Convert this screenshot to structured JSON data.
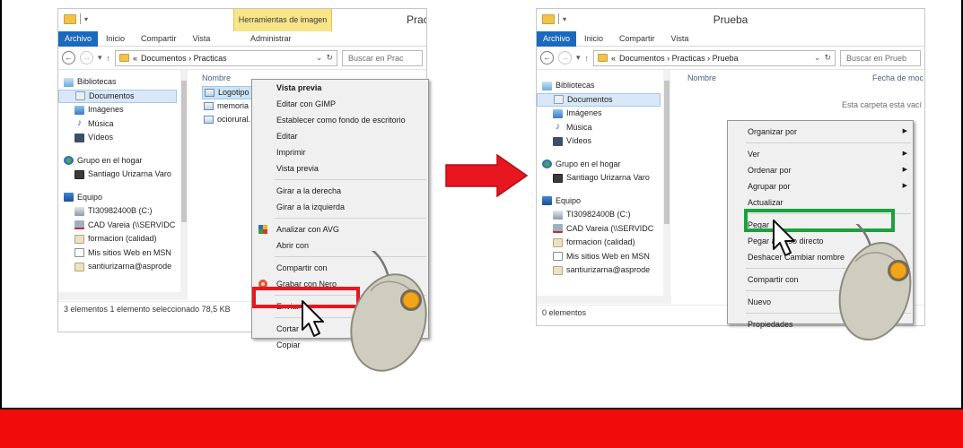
{
  "left": {
    "title": "Prac",
    "contextual_tab": "Herramientas de imagen",
    "ribbon": {
      "file": "Archivo",
      "tabs": [
        "Inicio",
        "Compartir",
        "Vista"
      ],
      "admin": "Administrar"
    },
    "address": {
      "prefix": "«",
      "path": "Documentos  ›  Practicas",
      "search": "Buscar en Prac"
    },
    "nav": [
      {
        "label": "Bibliotecas",
        "icon": "library-icon"
      },
      {
        "label": "Documentos",
        "icon": "documents-icon"
      },
      {
        "label": "Imágenes",
        "icon": "pictures-icon"
      },
      {
        "label": "Música",
        "icon": "music-icon"
      },
      {
        "label": "Vídeos",
        "icon": "videos-icon"
      },
      {
        "label": "Grupo en el hogar",
        "icon": "homegroup-icon"
      },
      {
        "label": "Santiago Urizarna Varo",
        "icon": "user-icon"
      },
      {
        "label": "Equipo",
        "icon": "computer-icon"
      },
      {
        "label": "TI30982400B (C:)",
        "icon": "drive-icon"
      },
      {
        "label": "CAD Vareia (\\\\SERVIDC",
        "icon": "network-drive-icon"
      },
      {
        "label": "formacion (calidad)",
        "icon": "network-folder-icon"
      },
      {
        "label": "Mis sitios Web en MSN",
        "icon": "page-icon"
      },
      {
        "label": "santiurizarna@asprode",
        "icon": "network-folder-icon"
      }
    ],
    "column_header": "Nombre",
    "files": [
      "Logotipo",
      "memoria",
      "ociorural."
    ],
    "status": "3 elementos    1 elemento seleccionado  78,5 KB",
    "menu": [
      {
        "label": "Vista previa",
        "bold": true
      },
      {
        "label": "Editar con GIMP"
      },
      {
        "label": "Establecer como fondo de escritorio"
      },
      {
        "label": "Editar"
      },
      {
        "label": "Imprimir"
      },
      {
        "label": "Vista previa"
      },
      {
        "sep": true
      },
      {
        "label": "Girar a la derecha"
      },
      {
        "label": "Girar a la izquierda"
      },
      {
        "sep": true
      },
      {
        "label": "Analizar con AVG",
        "icon": "avg-icon"
      },
      {
        "label": "Abrir con"
      },
      {
        "sep": true
      },
      {
        "label": "Compartir con"
      },
      {
        "label": "Grabar con Nero",
        "icon": "nero-icon"
      },
      {
        "sep": true
      },
      {
        "label": "Enviar a"
      },
      {
        "sep": true
      },
      {
        "label": "Cortar"
      },
      {
        "label": "Copiar"
      }
    ]
  },
  "right": {
    "title": "Prueba",
    "ribbon": {
      "file": "Archivo",
      "tabs": [
        "Inicio",
        "Compartir",
        "Vista"
      ]
    },
    "address": {
      "prefix": "«",
      "path": "Documentos  ›  Practicas  ›  Prueba",
      "search": "Buscar en Prueb"
    },
    "nav": [
      {
        "label": "Bibliotecas",
        "icon": "library-icon"
      },
      {
        "label": "Documentos",
        "icon": "documents-icon"
      },
      {
        "label": "Imágenes",
        "icon": "pictures-icon"
      },
      {
        "label": "Música",
        "icon": "music-icon"
      },
      {
        "label": "Vídeos",
        "icon": "videos-icon"
      },
      {
        "label": "Grupo en el hogar",
        "icon": "homegroup-icon"
      },
      {
        "label": "Santiago Urizarna Varo",
        "icon": "user-icon"
      },
      {
        "label": "Equipo",
        "icon": "computer-icon"
      },
      {
        "label": "TI30982400B (C:)",
        "icon": "drive-icon"
      },
      {
        "label": "CAD Vareia (\\\\SERVIDC",
        "icon": "network-drive-icon"
      },
      {
        "label": "formacion (calidad)",
        "icon": "network-folder-icon"
      },
      {
        "label": "Mis sitios Web en MSN",
        "icon": "page-icon"
      },
      {
        "label": "santiurizarna@asprode",
        "icon": "network-folder-icon"
      }
    ],
    "column_header": "Nombre",
    "column_header_2": "Fecha de moc",
    "empty_message": "Esta carpeta está vací",
    "status": "0 elementos",
    "menu": [
      {
        "label": "Organizar por",
        "sub": true
      },
      {
        "sep": true
      },
      {
        "label": "Ver",
        "sub": true
      },
      {
        "label": "Ordenar por",
        "sub": true
      },
      {
        "label": "Agrupar por",
        "sub": true
      },
      {
        "label": "Actualizar"
      },
      {
        "sep": true
      },
      {
        "label": "Pegar"
      },
      {
        "label": "Pegar acceso directo"
      },
      {
        "label": "Deshacer Cambiar nombre"
      },
      {
        "sep": true
      },
      {
        "label": "Compartir con"
      },
      {
        "sep": true
      },
      {
        "label": "Nuevo"
      },
      {
        "sep": true
      },
      {
        "label": "Propiedades"
      }
    ]
  },
  "colors": {
    "highlight_cut": "#e8161e",
    "highlight_paste": "#19a23b",
    "arrow": "#e8161e",
    "banner": "#f20b0b"
  }
}
